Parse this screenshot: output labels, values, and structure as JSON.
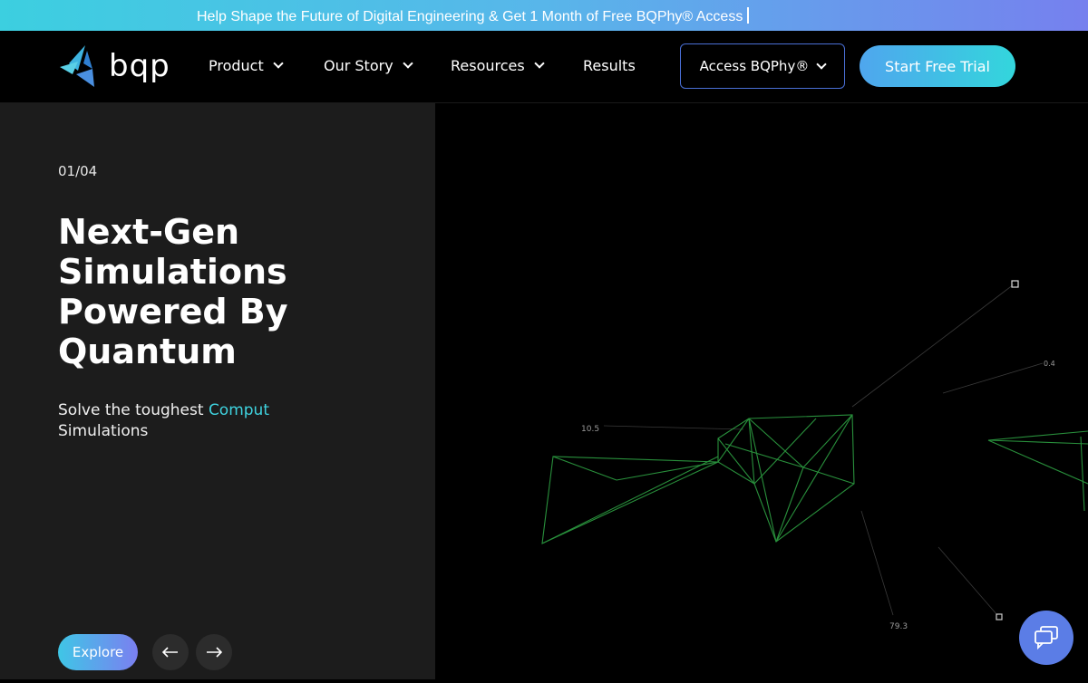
{
  "banner": {
    "text": "Help Shape the Future of Digital Engineering & Get 1 Month of Free BQPhy® Access"
  },
  "logo": {
    "text": "bqp",
    "icon": "bqp-logo-icon"
  },
  "nav": {
    "items": [
      {
        "label": "Product",
        "has_dropdown": true
      },
      {
        "label": "Our Story",
        "has_dropdown": true
      },
      {
        "label": "Resources",
        "has_dropdown": true
      },
      {
        "label": "Results",
        "has_dropdown": false
      }
    ],
    "access_label": "Access BQPhy®",
    "trial_label": "Start Free Trial"
  },
  "hero": {
    "counter": "01/04",
    "headline": "Next-Gen Simulations Powered By Quantum",
    "sub_prefix": "Solve the toughest ",
    "sub_highlight": "Comput",
    "sub_line2": "Simulations",
    "explore_label": "Explore",
    "prev_icon": "arrow-left-icon",
    "next_icon": "arrow-right-icon"
  },
  "visual": {
    "labels": [
      "10.5",
      "0.4",
      "79.3"
    ],
    "mesh_color": "#2ea043"
  },
  "chat": {
    "icon": "chat-icon"
  },
  "colors": {
    "accent_cyan": "#3fd3df",
    "accent_blue": "#5b7de6",
    "panel": "#1c1c1c"
  }
}
